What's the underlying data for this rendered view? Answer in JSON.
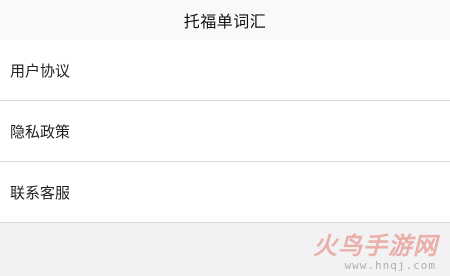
{
  "header": {
    "title": "托福单词汇"
  },
  "menu": {
    "items": [
      {
        "label": "用户协议"
      },
      {
        "label": "隐私政策"
      },
      {
        "label": "联系客服"
      }
    ]
  },
  "watermark": {
    "brand": "火鸟手游网",
    "url": "www.hnqj.com"
  },
  "colors": {
    "background": "#f2f2f4",
    "item_background": "#ffffff",
    "divider": "#d9d9dc"
  }
}
